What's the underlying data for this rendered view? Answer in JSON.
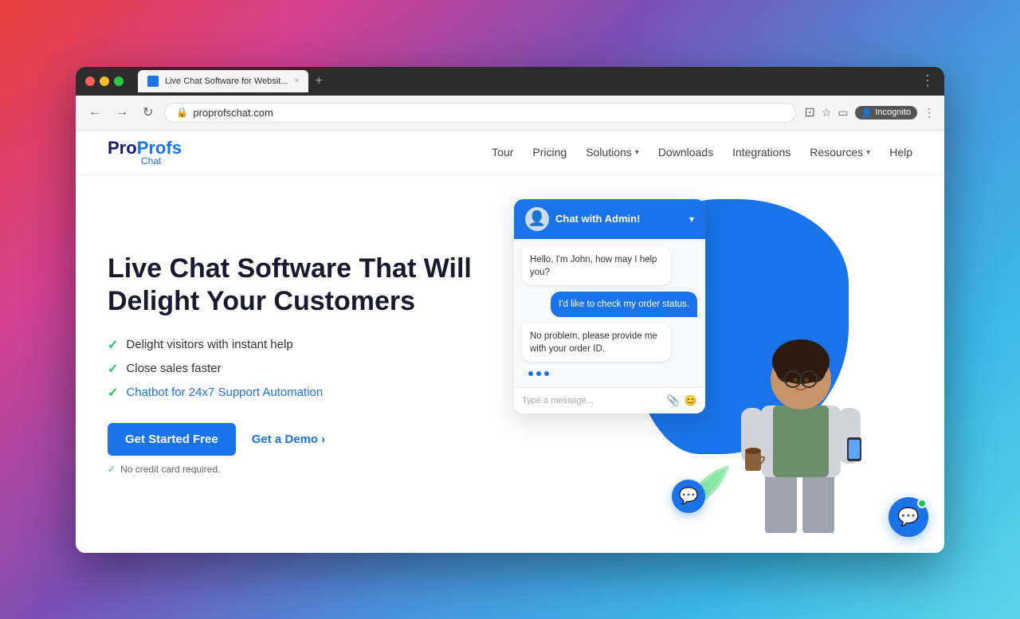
{
  "browser": {
    "tab_label": "Live Chat Software for Websit...",
    "url": "proprofschat.com",
    "tab_close": "×",
    "tab_new": "+",
    "incognito_label": "Incognito"
  },
  "nav": {
    "logo_pro": "Pro",
    "logo_profs": "Profs",
    "logo_chat": "Chat",
    "links": [
      {
        "label": "Tour",
        "has_dropdown": false
      },
      {
        "label": "Pricing",
        "has_dropdown": false
      },
      {
        "label": "Solutions",
        "has_dropdown": true
      },
      {
        "label": "Downloads",
        "has_dropdown": false
      },
      {
        "label": "Integrations",
        "has_dropdown": false
      },
      {
        "label": "Resources",
        "has_dropdown": true
      },
      {
        "label": "Help",
        "has_dropdown": false
      }
    ]
  },
  "hero": {
    "title_line1": "Live Chat Software That Will",
    "title_line2": "Delight Your Customers",
    "features": [
      {
        "text": "Delight visitors with instant help",
        "is_link": false
      },
      {
        "text": "Close sales faster",
        "is_link": false
      },
      {
        "text": "Chatbot for 24x7 Support Automation",
        "is_link": true
      }
    ],
    "cta_primary": "Get Started Free",
    "cta_demo": "Get a Demo",
    "no_cc_text": "No credit card required."
  },
  "chat_widget": {
    "header_title": "Chat with Admin!",
    "messages": [
      {
        "type": "agent",
        "text": "Hello, I'm John, how may I help you?"
      },
      {
        "type": "user",
        "text": "I'd like to check my order status."
      },
      {
        "type": "agent",
        "text": "No problem, please provide me with your order ID."
      }
    ],
    "input_placeholder": "Type a message..."
  }
}
